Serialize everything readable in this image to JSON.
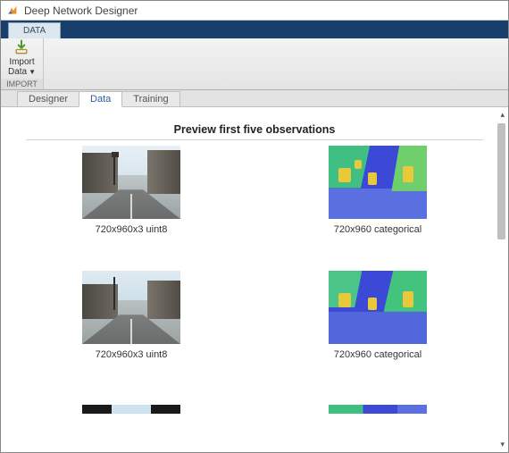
{
  "window": {
    "title": "Deep Network Designer"
  },
  "ribbon": {
    "main_tab": "DATA",
    "import_line1": "Import",
    "import_line2": "Data",
    "group_label": "IMPORT"
  },
  "subtabs": {
    "designer": "Designer",
    "data": "Data",
    "training": "Training"
  },
  "preview": {
    "title": "Preview first five observations",
    "rows": [
      {
        "img_caption": "720x960x3 uint8",
        "seg_caption": "720x960 categorical"
      },
      {
        "img_caption": "720x960x3 uint8",
        "seg_caption": "720x960 categorical"
      }
    ]
  }
}
